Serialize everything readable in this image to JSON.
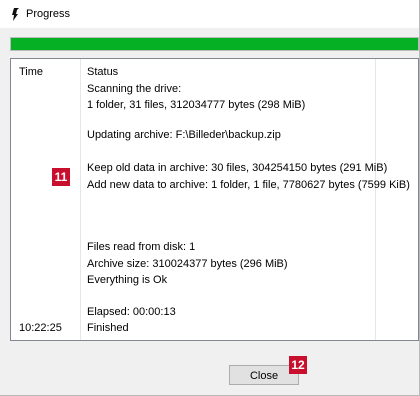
{
  "window": {
    "title": "Progress"
  },
  "progress": {
    "fraction": 1.0,
    "color": "#06b025"
  },
  "log": {
    "headers": {
      "time": "Time",
      "status": "Status"
    },
    "lines": [
      "Scanning the drive:",
      "1 folder, 31 files, 312034777 bytes (298 MiB)",
      "Updating archive: F:\\Billeder\\backup.zip",
      "Keep old data in archive: 30 files, 304254150 bytes (291 MiB)",
      "Add new data to archive: 1 folder, 1 file, 7780627 bytes (7599 KiB)",
      "Files read from disk: 1",
      "Archive size: 310024377 bytes (296 MiB)",
      "Everything is Ok",
      "Elapsed: 00:00:13",
      "Finished"
    ],
    "finished_time": "10:22:25"
  },
  "markers": {
    "first": "11",
    "second": "12"
  },
  "buttons": {
    "close": "Close"
  },
  "colors": {
    "marker": "#c8102e"
  }
}
